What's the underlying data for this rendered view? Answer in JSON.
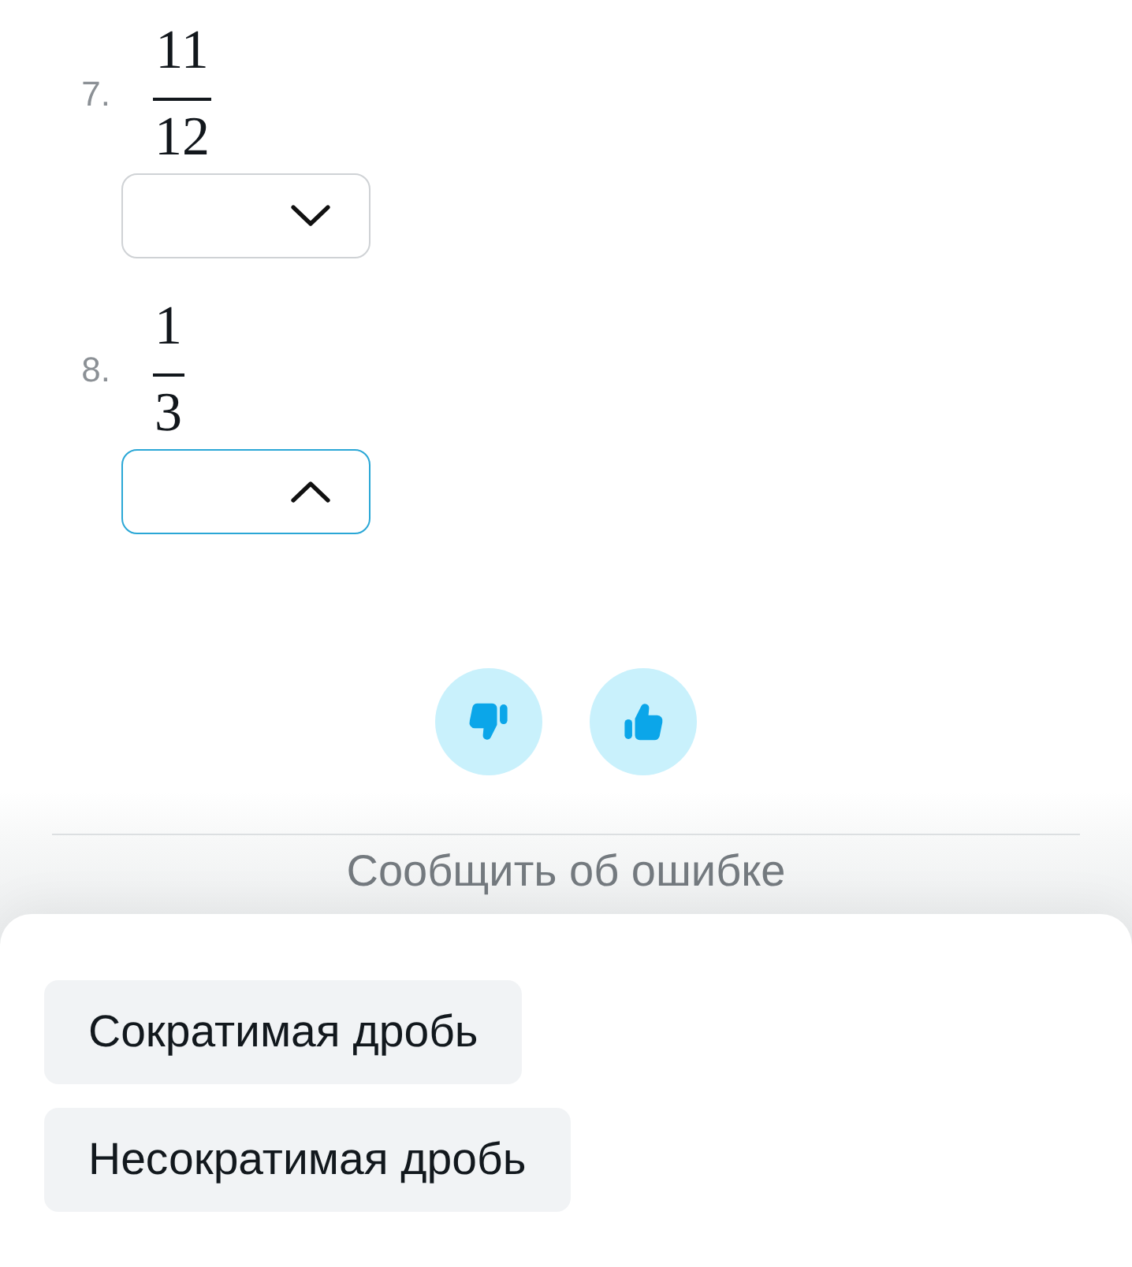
{
  "questions": [
    {
      "number": "7.",
      "fraction": {
        "numerator": "11",
        "denominator": "12"
      },
      "answer": {
        "expanded": false
      }
    },
    {
      "number": "8.",
      "fraction": {
        "numerator": "1",
        "denominator": "3"
      },
      "answer": {
        "expanded": true
      }
    }
  ],
  "feedback": {
    "buttons": [
      {
        "kind": "dislike"
      },
      {
        "kind": "like"
      }
    ]
  },
  "report_link": "Сообщить об ошибке",
  "answer_menu": {
    "options": [
      {
        "label": "Сократимая дробь"
      },
      {
        "label": "Несократимая дробь"
      }
    ]
  }
}
